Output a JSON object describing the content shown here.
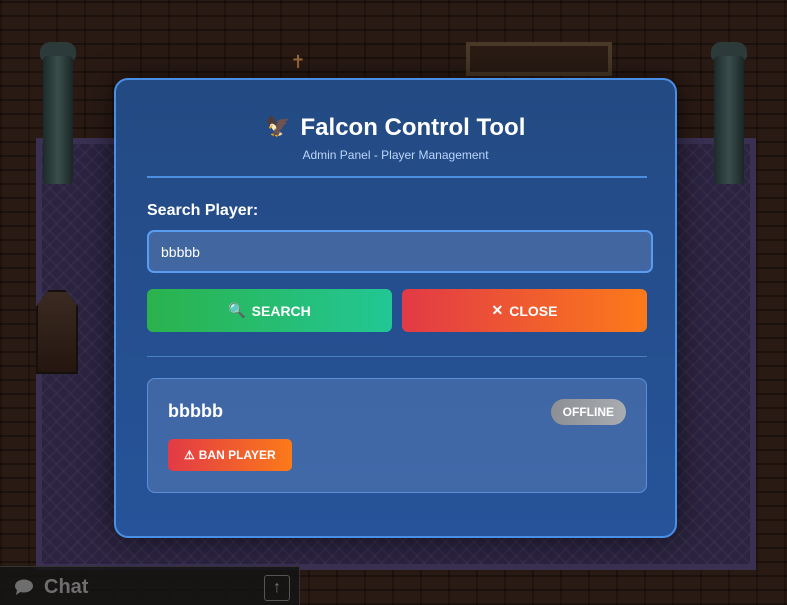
{
  "chat": {
    "label": "Chat",
    "up_glyph": "↑",
    "icon": "chat-bubble-icon"
  },
  "modal": {
    "logo": "🦅",
    "logo_icon": "falcon-icon",
    "title": "Falcon Control Tool",
    "subtitle": "Admin Panel - Player Management",
    "search_label": "Search Player:",
    "search_value": "bbbbb",
    "search_button": {
      "icon": "🔍",
      "label": "SEARCH"
    },
    "close_button": {
      "icon": "✕",
      "label": "CLOSE"
    },
    "player": {
      "name": "bbbbb",
      "status": "OFFLINE",
      "ban_button": {
        "icon": "⚠",
        "label": "BAN PLAYER"
      }
    }
  },
  "colors": {
    "modal_bg": "#234a82",
    "modal_border": "#4a8fe6",
    "search_btn": "#2bb24c",
    "close_btn": "#e23a46",
    "offline_badge": "#8c8f93"
  }
}
